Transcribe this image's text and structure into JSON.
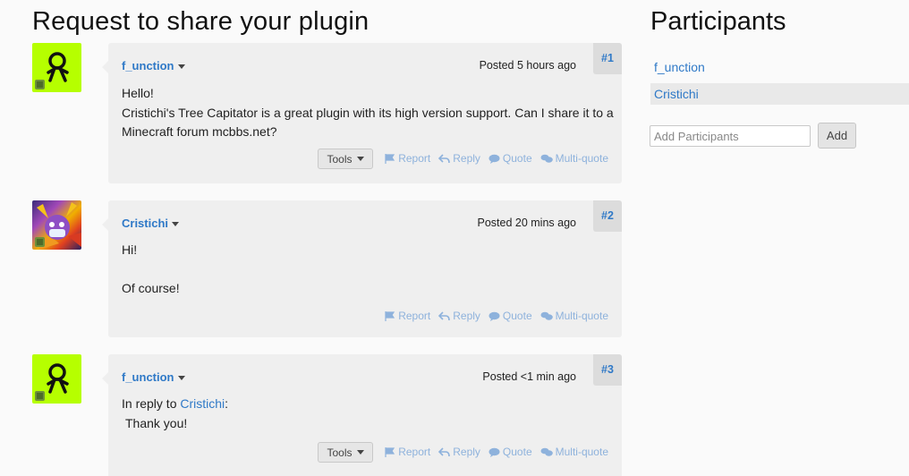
{
  "page": {
    "title": "Request to share your plugin"
  },
  "sidebar": {
    "title": "Participants",
    "participants": [
      "f_unction",
      "Cristichi"
    ],
    "add_placeholder": "Add Participants",
    "add_label": "Add"
  },
  "messages": [
    {
      "author": "f_unction",
      "posted": "Posted 5 hours ago",
      "number": "#1",
      "lines": [
        "Hello!",
        "Cristichi's Tree Capitator is a great plugin with its high version support. Can I share it to a Minecraft forum mcbbs.net?"
      ],
      "tools_label": "Tools"
    },
    {
      "author": "Cristichi",
      "posted": "Posted 20 mins ago",
      "number": "#2",
      "lines": [
        "Hi!",
        "Of course!"
      ]
    },
    {
      "author": "f_unction",
      "posted": "Posted <1 min ago",
      "number": "#3",
      "reply_prefix": "In reply to ",
      "reply_user": "Cristichi",
      "reply_suffix": ":",
      "lines": [
        "Thank you!"
      ],
      "tools_label": "Tools"
    }
  ],
  "actions": {
    "report": "Report",
    "reply": "Reply",
    "quote": "Quote",
    "multiquote": "Multi-quote"
  },
  "icons": {
    "flag": "flag-icon",
    "reply": "reply-icon",
    "quote": "quote-icon",
    "multiquote": "multiquote-icon"
  },
  "colors": {
    "link": "#2f79c7",
    "action": "#8eb2dc",
    "avatar_lime": "#b6ff00",
    "message_bg": "#efefef"
  }
}
